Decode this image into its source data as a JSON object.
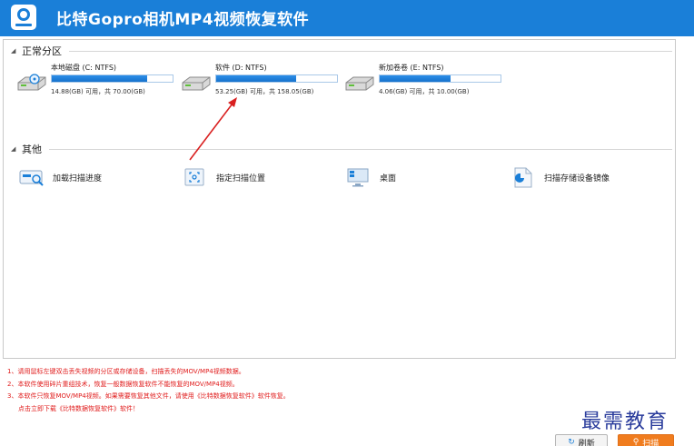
{
  "app": {
    "title": "比特Gopro相机MP4视频恢复软件"
  },
  "groups": {
    "partitions_title": "正常分区",
    "other_title": "其他"
  },
  "drives": [
    {
      "name": "本地磁盘 (C: NTFS)",
      "size": "14.88(GB) 可用，共 70.00(GB)",
      "fill_fraction": 0.79
    },
    {
      "name": "软件 (D: NTFS)",
      "size": "53.25(GB) 可用，共 158.05(GB)",
      "fill_fraction": 0.66
    },
    {
      "name": "新加卷卷 (E: NTFS)",
      "size": "4.06(GB) 可用，共 10.00(GB)",
      "fill_fraction": 0.59
    }
  ],
  "tools": [
    {
      "label": "加载扫描进度",
      "icon": "load-progress-icon"
    },
    {
      "label": "指定扫描位置",
      "icon": "target-location-icon"
    },
    {
      "label": "桌面",
      "icon": "desktop-icon"
    },
    {
      "label": "扫描存储设备镜像",
      "icon": "disk-image-icon"
    }
  ],
  "notes": [
    "1、请用鼠标左键双击丢失视频的分区或存储设备，扫描丢失的MOV/MP4视频数据。",
    "2、本软件使用碎片重组技术，恢复一般数据恢复软件不能恢复的MOV/MP4视频。",
    "3、本软件只恢复MOV/MP4视频。如果需要恢复其他文件，请使用《比特数据恢复软件》软件恢复。",
    "点击立即下载《比特数据恢复软件》软件！"
  ],
  "watermark": "最需教育",
  "buttons": {
    "refresh": "刷新",
    "scan": "扫描"
  },
  "colors": {
    "titlebar": "#1a7fd8",
    "progress": "#1f7fdc",
    "note_text": "#e01b1b",
    "scan_button": "#f07c1e",
    "annotation_arrow": "#d92020"
  }
}
